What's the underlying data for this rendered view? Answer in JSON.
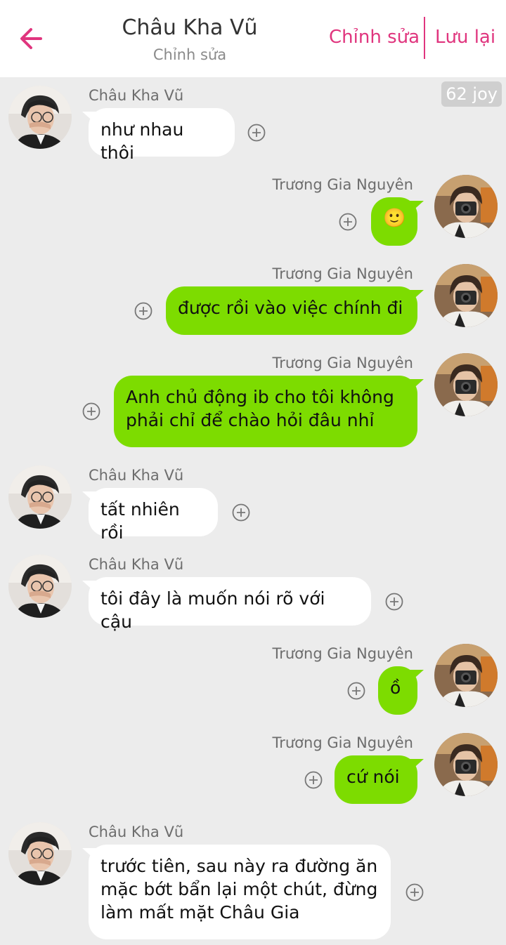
{
  "header": {
    "title": "Châu Kha Vũ",
    "subtitle": "Chỉnh sửa",
    "edit_label": "Chỉnh sửa",
    "save_label": "Lưu lại"
  },
  "joy_badge": "62 joy",
  "colors": {
    "accent": "#e0357e",
    "outgoing_bubble": "#7ddc00",
    "incoming_bubble": "#ffffff",
    "background": "#ececec"
  },
  "messages": [
    {
      "side": "in",
      "sender": "Châu Kha Vũ",
      "lines": [
        "như nhau thôi"
      ]
    },
    {
      "side": "out",
      "sender": "Trương Gia Nguyên",
      "lines": [
        "🙂"
      ],
      "emoji": true
    },
    {
      "side": "out",
      "sender": "Trương Gia Nguyên",
      "lines": [
        "được rồi vào việc chính đi"
      ]
    },
    {
      "side": "out",
      "sender": "Trương Gia Nguyên",
      "lines": [
        "Anh chủ động ib cho tôi không",
        "phải chỉ để chào hỏi đâu nhỉ"
      ]
    },
    {
      "side": "in",
      "sender": "Châu Kha Vũ",
      "lines": [
        "tất nhiên rồi"
      ]
    },
    {
      "side": "in",
      "sender": "Châu Kha Vũ",
      "lines": [
        "tôi đây là muốn nói rõ với cậu"
      ]
    },
    {
      "side": "out",
      "sender": "Trương Gia Nguyên",
      "lines": [
        "ồ"
      ]
    },
    {
      "side": "out",
      "sender": "Trương Gia Nguyên",
      "lines": [
        "cứ nói"
      ]
    },
    {
      "side": "in",
      "sender": "Châu Kha Vũ",
      "lines": [
        "trước tiên, sau này ra đường ăn",
        "mặc bớt bẩn lại một chút, đừng",
        "làm mất mặt Châu Gia"
      ]
    }
  ]
}
